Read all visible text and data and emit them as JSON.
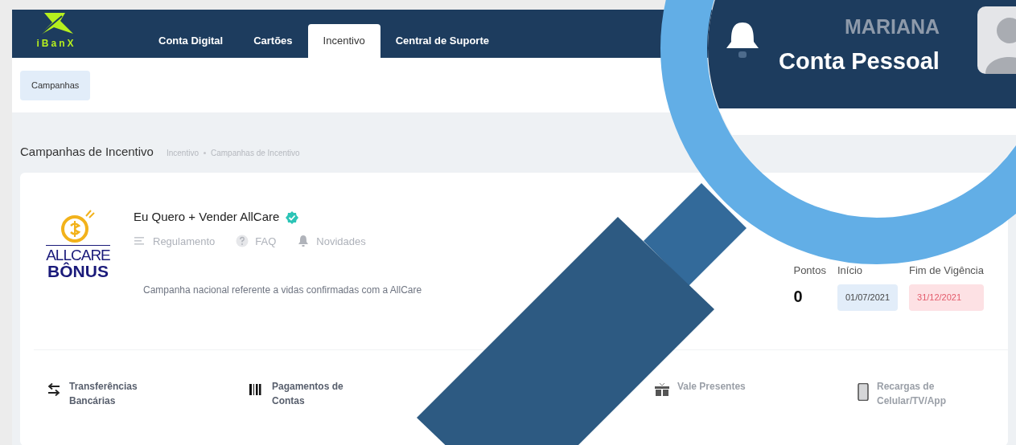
{
  "header": {
    "logo": "iBanX",
    "tabs": [
      {
        "label": "Conta Digital",
        "selected": false
      },
      {
        "label": "Cartões",
        "selected": false
      },
      {
        "label": "Incentivo",
        "selected": true
      },
      {
        "label": "Central de Suporte",
        "selected": false
      }
    ],
    "user": {
      "name": "MARIANA",
      "account": "Conta Pessoal"
    }
  },
  "subnav": [
    {
      "label": "Campanhas",
      "selected": true
    }
  ],
  "page": {
    "title": "Campanhas de Incentivo",
    "breadcrumb": [
      "Incentivo",
      "Campanhas de Incentivo"
    ]
  },
  "campaign": {
    "logo_lines": [
      "ALLCARE",
      "BÔNUS"
    ],
    "title": "Eu Quero + Vender AllCare",
    "verified": true,
    "links": [
      {
        "kind": "rules",
        "label": "Regulamento"
      },
      {
        "kind": "faq",
        "label": "FAQ"
      },
      {
        "kind": "news",
        "label": "Novidades"
      }
    ],
    "description": "Campanha nacional referente a vidas confirmadas com a AllCare",
    "stats": [
      {
        "kind": "points",
        "label": "Pontos",
        "value": "0"
      },
      {
        "kind": "start",
        "label": "Início",
        "value": "01/07/2021"
      },
      {
        "kind": "end",
        "label": "Fim de Vigência",
        "value": "31/12/2021"
      }
    ]
  },
  "services": [
    {
      "kind": "transfer",
      "label": "Transferências Bancárias"
    },
    {
      "kind": "bills",
      "label": "Pagamentos de Contas"
    },
    {
      "kind": "gift",
      "label": "Vale Presentes"
    },
    {
      "kind": "phone",
      "label": "Recargas de Celular/TV/App"
    }
  ]
}
